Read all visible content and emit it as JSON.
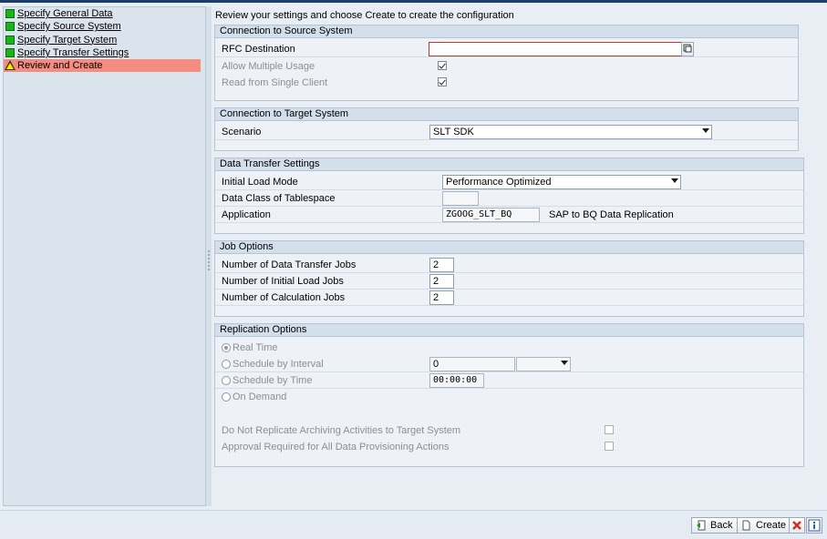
{
  "nav": {
    "items": [
      {
        "label": "Specify General Data",
        "icon": "green-status-icon",
        "active": false
      },
      {
        "label": "Specify Source System",
        "icon": "green-status-icon",
        "active": false
      },
      {
        "label": "Specify Target System",
        "icon": "green-status-icon",
        "active": false
      },
      {
        "label": "Specify Transfer Settings",
        "icon": "green-status-icon",
        "active": false
      },
      {
        "label": "Review and Create",
        "icon": "warning-icon",
        "active": true
      }
    ]
  },
  "intro": "Review your settings and choose Create to create the configuration",
  "source": {
    "title": "Connection to Source System",
    "rfc_label": "RFC Destination",
    "rfc_value": "",
    "multi_label": "Allow Multiple Usage",
    "multi_checked": true,
    "single_label": "Read from Single Client",
    "single_checked": true
  },
  "target": {
    "title": "Connection to Target System",
    "scenario_label": "Scenario",
    "scenario_value": "SLT SDK"
  },
  "transfer": {
    "title": "Data Transfer Settings",
    "load_mode_label": "Initial Load Mode",
    "load_mode_value": "Performance Optimized",
    "data_class_label": "Data Class of Tablespace",
    "data_class_value": "",
    "app_label": "Application",
    "app_value": "ZGOOG_SLT_BQ",
    "app_desc": "SAP to BQ Data Replication"
  },
  "jobs": {
    "title": "Job Options",
    "transfer_label": "Number of Data Transfer Jobs",
    "transfer_value": "2",
    "initial_label": "Number of Initial Load Jobs",
    "initial_value": "2",
    "calc_label": "Number of Calculation Jobs",
    "calc_value": "2"
  },
  "replication": {
    "title": "Replication Options",
    "realtime_label": "Real Time",
    "interval_label": "Schedule by Interval",
    "interval_value": "0",
    "interval_unit": "",
    "time_label": "Schedule by Time",
    "time_value": "00:00:00",
    "demand_label": "On Demand",
    "selected": "Real Time",
    "archiving_label": "Do Not Replicate Archiving Activities to Target System",
    "archiving_checked": false,
    "approval_label": "Approval Required for All Data Provisioning Actions",
    "approval_checked": false
  },
  "footer": {
    "back_label": "Back",
    "create_label": "Create"
  },
  "colors": {
    "active_step": "#f48c80",
    "ok_status": "#18b418",
    "section_header": "#d3dfea"
  }
}
